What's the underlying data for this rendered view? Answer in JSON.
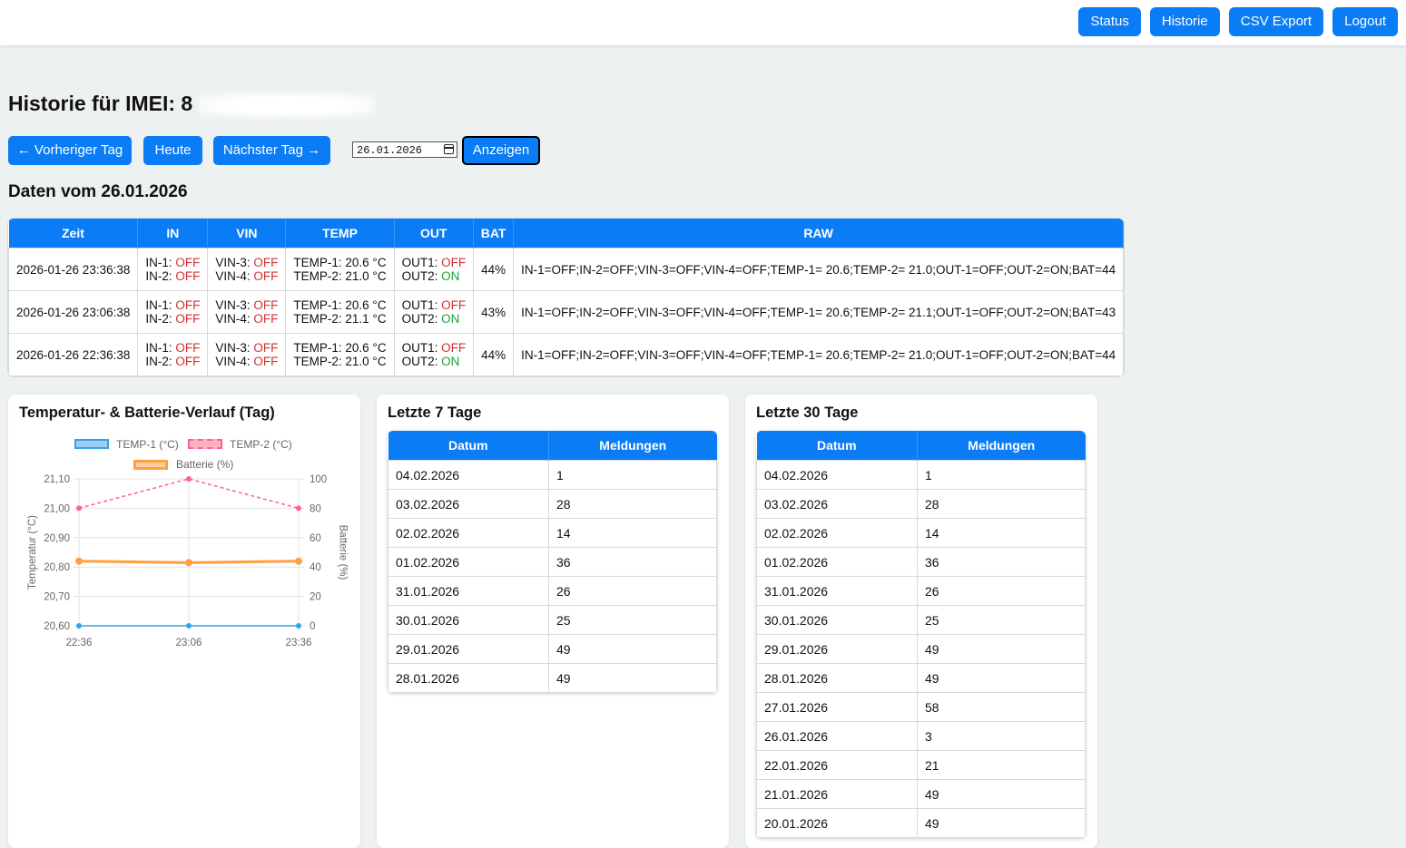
{
  "nav": [
    "Status",
    "Historie",
    "CSV Export",
    "Logout"
  ],
  "page": {
    "title": "Historie für IMEI: 8",
    "prev_label": "← Vorheriger Tag",
    "today_label": "Heute",
    "next_label": "Nächster Tag →",
    "date_value": "26.01.2026",
    "show_label": "Anzeigen",
    "day_heading": "Daten vom 26.01.2026"
  },
  "table": {
    "headers": [
      "Zeit",
      "IN",
      "VIN",
      "TEMP",
      "OUT",
      "BAT",
      "RAW"
    ],
    "rows": [
      {
        "zeit": "2026-01-26 23:36:38",
        "in1_label": "IN-1: ",
        "in1": "OFF",
        "in2_label": "IN-2: ",
        "in2": "OFF",
        "vin3_label": "VIN-3: ",
        "vin3": "OFF",
        "vin4_label": "VIN-4: ",
        "vin4": "OFF",
        "temp1": "TEMP-1: 20.6 °C",
        "temp2": "TEMP-2: 21.0 °C",
        "out1_label": "OUT1: ",
        "out1": "OFF",
        "out2_label": "OUT2: ",
        "out2": "ON",
        "bat": "44%",
        "raw": "IN-1=OFF;IN-2=OFF;VIN-3=OFF;VIN-4=OFF;TEMP-1= 20.6;TEMP-2= 21.0;OUT-1=OFF;OUT-2=ON;BAT=44"
      },
      {
        "zeit": "2026-01-26 23:06:38",
        "in1_label": "IN-1: ",
        "in1": "OFF",
        "in2_label": "IN-2: ",
        "in2": "OFF",
        "vin3_label": "VIN-3: ",
        "vin3": "OFF",
        "vin4_label": "VIN-4: ",
        "vin4": "OFF",
        "temp1": "TEMP-1: 20.6 °C",
        "temp2": "TEMP-2: 21.1 °C",
        "out1_label": "OUT1: ",
        "out1": "OFF",
        "out2_label": "OUT2: ",
        "out2": "ON",
        "bat": "43%",
        "raw": "IN-1=OFF;IN-2=OFF;VIN-3=OFF;VIN-4=OFF;TEMP-1= 20.6;TEMP-2= 21.1;OUT-1=OFF;OUT-2=ON;BAT=43"
      },
      {
        "zeit": "2026-01-26 22:36:38",
        "in1_label": "IN-1: ",
        "in1": "OFF",
        "in2_label": "IN-2: ",
        "in2": "OFF",
        "vin3_label": "VIN-3: ",
        "vin3": "OFF",
        "vin4_label": "VIN-4: ",
        "vin4": "OFF",
        "temp1": "TEMP-1: 20.6 °C",
        "temp2": "TEMP-2: 21.0 °C",
        "out1_label": "OUT1: ",
        "out1": "OFF",
        "out2_label": "OUT2: ",
        "out2": "ON",
        "bat": "44%",
        "raw": "IN-1=OFF;IN-2=OFF;VIN-3=OFF;VIN-4=OFF;TEMP-1= 20.6;TEMP-2= 21.0;OUT-1=OFF;OUT-2=ON;BAT=44"
      }
    ]
  },
  "chart_card": {
    "title": "Temperatur- & Batterie-Verlauf (Tag)"
  },
  "chart_data": {
    "type": "line",
    "categories": [
      "22:36",
      "23:06",
      "23:36"
    ],
    "series": [
      {
        "name": "TEMP-1 (°C)",
        "axis": "left",
        "values": [
          20.6,
          20.6,
          20.6
        ],
        "color": "#36a2eb"
      },
      {
        "name": "TEMP-2 (°C)",
        "axis": "left",
        "values": [
          21.0,
          21.1,
          21.0
        ],
        "color": "#ff6384",
        "dashed": true
      },
      {
        "name": "Batterie (%)",
        "axis": "right",
        "values": [
          44,
          43,
          44
        ],
        "color": "#ff9f40"
      }
    ],
    "ylabel": "Temperatur (°C)",
    "y2label": "Batterie (%)",
    "ylim": [
      20.6,
      21.1
    ],
    "y2lim": [
      0,
      100
    ],
    "yticks": [
      "21,10",
      "21,00",
      "20,90",
      "20,80",
      "20,70",
      "20,60"
    ],
    "y2ticks": [
      "100",
      "80",
      "60",
      "40",
      "20",
      "0"
    ],
    "grid": true,
    "legend": "top"
  },
  "week": {
    "title": "Letzte 7 Tage",
    "headers": [
      "Datum",
      "Meldungen"
    ],
    "rows": [
      [
        "04.02.2026",
        "1"
      ],
      [
        "03.02.2026",
        "28"
      ],
      [
        "02.02.2026",
        "14"
      ],
      [
        "01.02.2026",
        "36"
      ],
      [
        "31.01.2026",
        "26"
      ],
      [
        "30.01.2026",
        "25"
      ],
      [
        "29.01.2026",
        "49"
      ],
      [
        "28.01.2026",
        "49"
      ]
    ]
  },
  "month": {
    "title": "Letzte 30 Tage",
    "headers": [
      "Datum",
      "Meldungen"
    ],
    "rows": [
      [
        "04.02.2026",
        "1"
      ],
      [
        "03.02.2026",
        "28"
      ],
      [
        "02.02.2026",
        "14"
      ],
      [
        "01.02.2026",
        "36"
      ],
      [
        "31.01.2026",
        "26"
      ],
      [
        "30.01.2026",
        "25"
      ],
      [
        "29.01.2026",
        "49"
      ],
      [
        "28.01.2026",
        "49"
      ],
      [
        "27.01.2026",
        "58"
      ],
      [
        "26.01.2026",
        "3"
      ],
      [
        "22.01.2026",
        "21"
      ],
      [
        "21.01.2026",
        "49"
      ],
      [
        "20.01.2026",
        "49"
      ]
    ]
  }
}
